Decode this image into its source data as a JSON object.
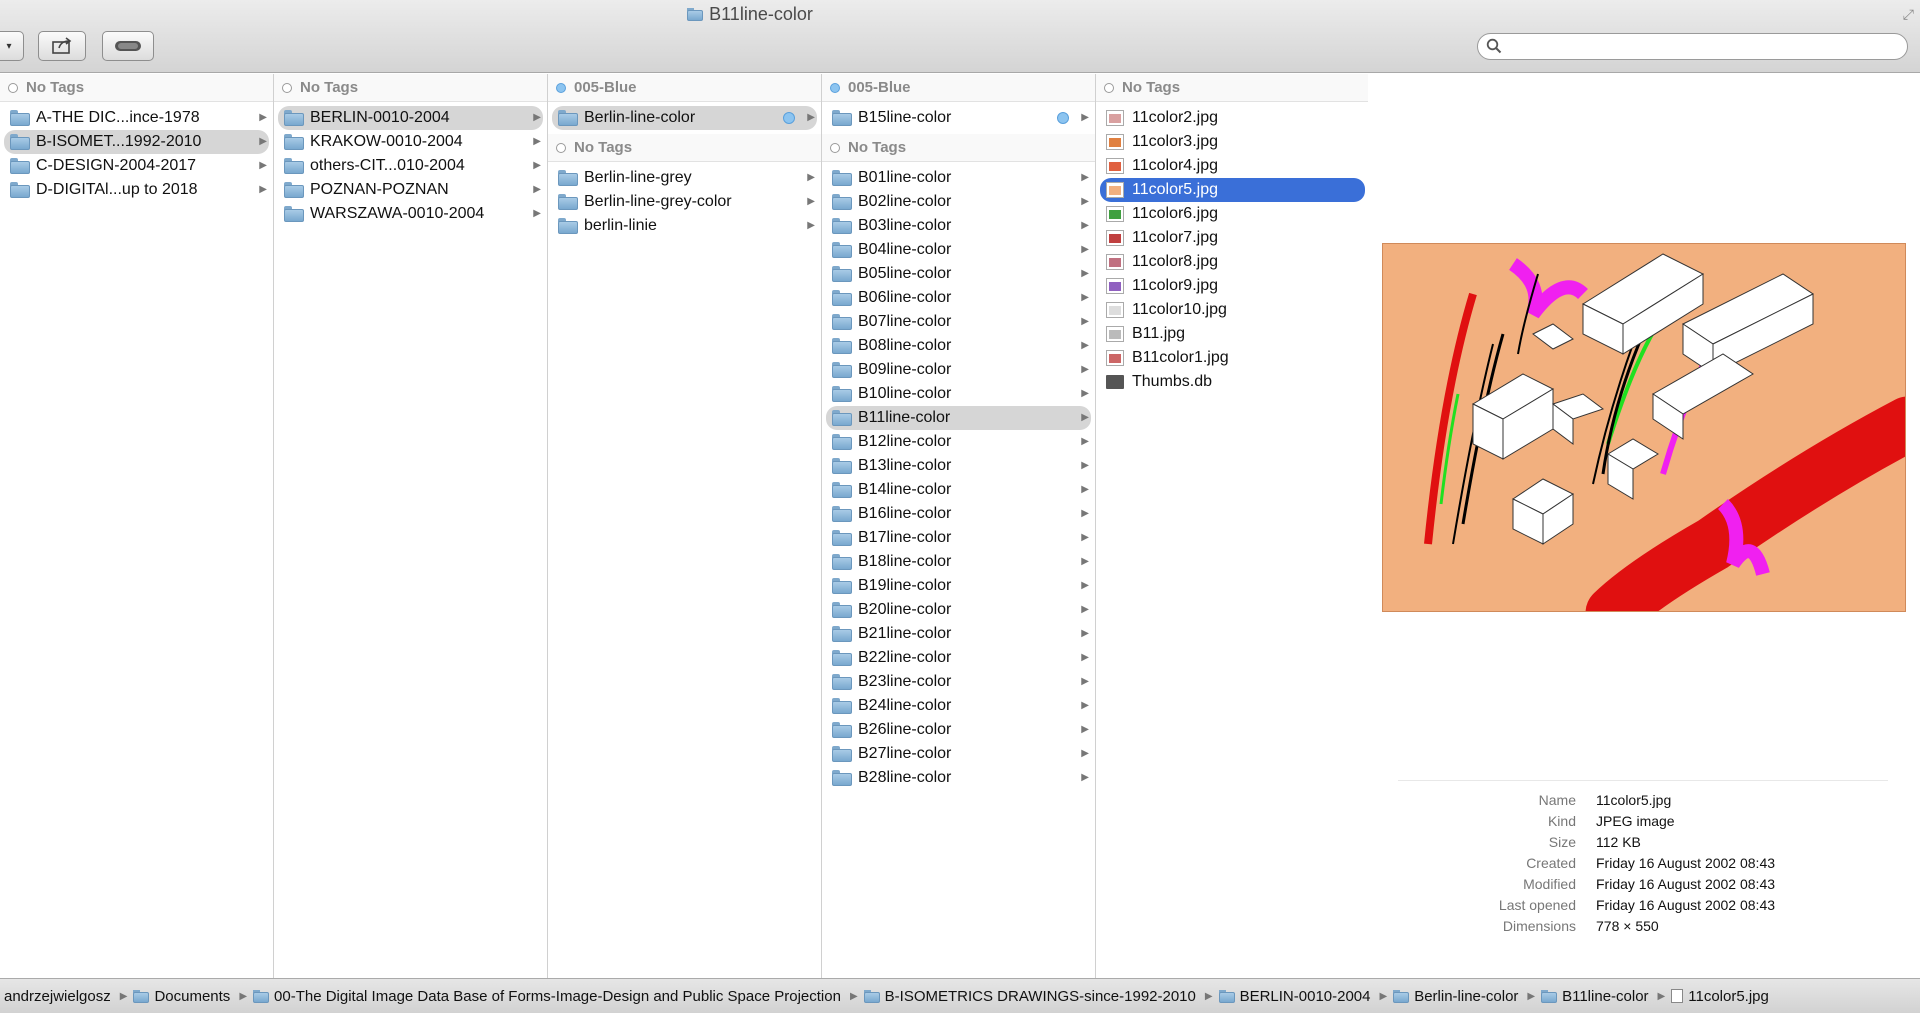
{
  "window": {
    "title": "B11line-color",
    "search_placeholder": ""
  },
  "toolbar": {
    "buttons": [
      "view-options-dropdown",
      "share",
      "toggle-tags"
    ]
  },
  "columns": [
    {
      "tag": "No Tags",
      "tag_color": "none",
      "items": [
        {
          "label": "A-THE DIC...ince-1978",
          "type": "folder",
          "selected": false
        },
        {
          "label": "B-ISOMET...1992-2010",
          "type": "folder",
          "selected": true
        },
        {
          "label": "C-DESIGN-2004-2017",
          "type": "folder",
          "selected": false
        },
        {
          "label": "D-DIGITAl...up to 2018",
          "type": "folder",
          "selected": false
        }
      ]
    },
    {
      "tag": "No Tags",
      "tag_color": "none",
      "items": [
        {
          "label": "BERLIN-0010-2004",
          "type": "folder",
          "selected": true
        },
        {
          "label": "KRAKOW-0010-2004",
          "type": "folder",
          "selected": false
        },
        {
          "label": "others-CIT...010-2004",
          "type": "folder",
          "selected": false
        },
        {
          "label": "POZNAN-POZNAN",
          "type": "folder",
          "selected": false
        },
        {
          "label": "WARSZAWA-0010-2004",
          "type": "folder",
          "selected": false
        }
      ]
    },
    {
      "tag": "005-Blue",
      "tag_color": "#8cc4f0",
      "items": [
        {
          "label": "Berlin-line-color",
          "type": "folder",
          "selected": true,
          "tagged": true
        }
      ],
      "sub_tag": "No Tags",
      "sub_items": [
        {
          "label": "Berlin-line-grey",
          "type": "folder"
        },
        {
          "label": "Berlin-line-grey-color",
          "type": "folder"
        },
        {
          "label": "berlin-linie",
          "type": "folder"
        }
      ]
    },
    {
      "tag": "005-Blue",
      "tag_color": "#8cc4f0",
      "items": [
        {
          "label": "B15line-color",
          "type": "folder",
          "selected": false,
          "tagged": true
        }
      ],
      "sub_tag": "No Tags",
      "sub_items": [
        {
          "label": "B01line-color",
          "type": "folder"
        },
        {
          "label": "B02line-color",
          "type": "folder"
        },
        {
          "label": "B03line-color",
          "type": "folder"
        },
        {
          "label": "B04line-color",
          "type": "folder"
        },
        {
          "label": "B05line-color",
          "type": "folder"
        },
        {
          "label": "B06line-color",
          "type": "folder"
        },
        {
          "label": "B07line-color",
          "type": "folder"
        },
        {
          "label": "B08line-color",
          "type": "folder"
        },
        {
          "label": "B09line-color",
          "type": "folder"
        },
        {
          "label": "B10line-color",
          "type": "folder"
        },
        {
          "label": "B11line-color",
          "type": "folder",
          "selected": true
        },
        {
          "label": "B12line-color",
          "type": "folder"
        },
        {
          "label": "B13line-color",
          "type": "folder"
        },
        {
          "label": "B14line-color",
          "type": "folder"
        },
        {
          "label": "B16line-color",
          "type": "folder"
        },
        {
          "label": "B17line-color",
          "type": "folder"
        },
        {
          "label": "B18line-color",
          "type": "folder"
        },
        {
          "label": "B19line-color",
          "type": "folder"
        },
        {
          "label": "B20line-color",
          "type": "folder"
        },
        {
          "label": "B21line-color",
          "type": "folder"
        },
        {
          "label": "B22line-color",
          "type": "folder"
        },
        {
          "label": "B23line-color",
          "type": "folder"
        },
        {
          "label": "B24line-color",
          "type": "folder"
        },
        {
          "label": "B26line-color",
          "type": "folder"
        },
        {
          "label": "B27line-color",
          "type": "folder"
        },
        {
          "label": "B28line-color",
          "type": "folder"
        }
      ]
    },
    {
      "tag": "No Tags",
      "tag_color": "none",
      "items": [
        {
          "label": "11color2.jpg",
          "type": "image",
          "thumb": "#d9a0a0"
        },
        {
          "label": "11color3.jpg",
          "type": "image",
          "thumb": "#e08040"
        },
        {
          "label": "11color4.jpg",
          "type": "image",
          "thumb": "#e06040"
        },
        {
          "label": "11color5.jpg",
          "type": "image",
          "thumb": "#f2b07f",
          "selected": true
        },
        {
          "label": "11color6.jpg",
          "type": "image",
          "thumb": "#40a040"
        },
        {
          "label": "11color7.jpg",
          "type": "image",
          "thumb": "#c04040"
        },
        {
          "label": "11color8.jpg",
          "type": "image",
          "thumb": "#c07080"
        },
        {
          "label": "11color9.jpg",
          "type": "image",
          "thumb": "#9060c0"
        },
        {
          "label": "11color10.jpg",
          "type": "image",
          "thumb": "#dddddd"
        },
        {
          "label": "B11.jpg",
          "type": "image",
          "thumb": "#bbbbbb"
        },
        {
          "label": "B11color1.jpg",
          "type": "image",
          "thumb": "#cc6666"
        },
        {
          "label": "Thumbs.db",
          "type": "db"
        }
      ]
    }
  ],
  "preview": {
    "background_color": "#f2b07f",
    "info": [
      {
        "label": "Name",
        "value": "11color5.jpg"
      },
      {
        "label": "Kind",
        "value": "JPEG image"
      },
      {
        "label": "Size",
        "value": "112 KB"
      },
      {
        "label": "Created",
        "value": "Friday 16 August 2002 08:43"
      },
      {
        "label": "Modified",
        "value": "Friday 16 August 2002 08:43"
      },
      {
        "label": "Last opened",
        "value": "Friday 16 August 2002 08:43"
      },
      {
        "label": "Dimensions",
        "value": "778 × 550"
      }
    ]
  },
  "pathbar": [
    {
      "label": "andrzejwielgosz",
      "icon": "none"
    },
    {
      "label": "Documents",
      "icon": "folder"
    },
    {
      "label": "00-The Digital Image Data Base of Forms-Image-Design and Public Space Projection",
      "icon": "folder"
    },
    {
      "label": "B-ISOMETRICS DRAWINGS-since-1992-2010",
      "icon": "folder"
    },
    {
      "label": "BERLIN-0010-2004",
      "icon": "folder"
    },
    {
      "label": "Berlin-line-color",
      "icon": "folder"
    },
    {
      "label": "B11line-color",
      "icon": "folder"
    },
    {
      "label": "11color5.jpg",
      "icon": "file"
    }
  ]
}
